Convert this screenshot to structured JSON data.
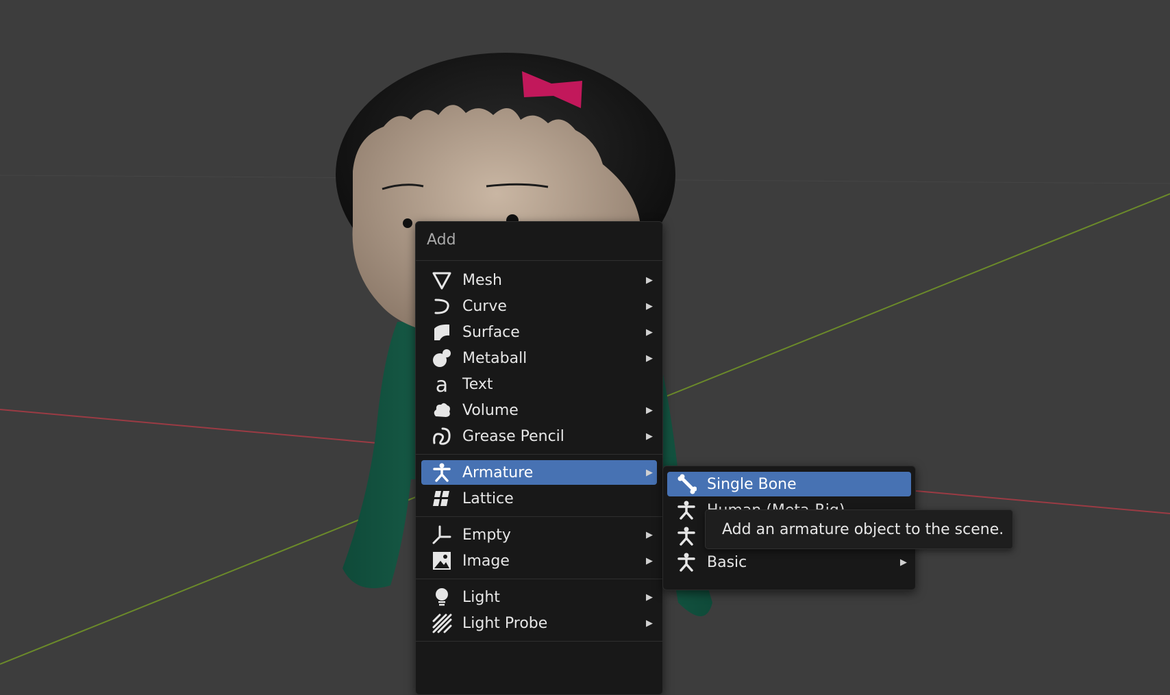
{
  "menu": {
    "title": "Add",
    "items": [
      {
        "label": "Mesh",
        "icon": "mesh-icon"
      },
      {
        "label": "Curve",
        "icon": "curve-icon"
      },
      {
        "label": "Surface",
        "icon": "surface-icon"
      },
      {
        "label": "Metaball",
        "icon": "metaball-icon"
      },
      {
        "label": "Text",
        "icon": "text-icon"
      },
      {
        "label": "Volume",
        "icon": "volume-icon"
      },
      {
        "label": "Grease Pencil",
        "icon": "grease-pencil-icon"
      },
      {
        "label": "Armature",
        "icon": "armature-icon"
      },
      {
        "label": "Lattice",
        "icon": "lattice-icon"
      },
      {
        "label": "Empty",
        "icon": "empty-icon"
      },
      {
        "label": "Image",
        "icon": "image-icon"
      },
      {
        "label": "Light",
        "icon": "light-icon"
      },
      {
        "label": "Light Probe",
        "icon": "light-probe-icon"
      }
    ]
  },
  "armature_submenu": {
    "items": [
      {
        "label": "Single Bone",
        "icon": "bone-icon"
      },
      {
        "label": "Human (Meta-Rig)",
        "icon": "armature-icon"
      },
      {
        "label": "",
        "icon": "armature-icon"
      },
      {
        "label": "Basic",
        "icon": "armature-icon"
      }
    ]
  },
  "tooltip": {
    "text": "Add an armature object to the scene."
  },
  "colors": {
    "background": "#3d3d3d",
    "menu_bg": "#181818",
    "highlight": "#4772b3",
    "x_axis": "#9b3b44",
    "y_axis": "#6b8a2a",
    "shirt": "#1a5e4a",
    "bow": "#c2185b"
  }
}
